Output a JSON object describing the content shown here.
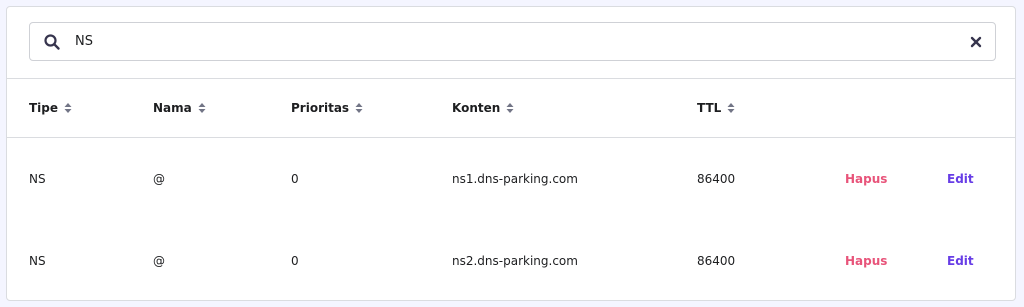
{
  "search": {
    "value": "NS",
    "placeholder": ""
  },
  "table": {
    "headers": [
      "Tipe",
      "Nama",
      "Prioritas",
      "Konten",
      "TTL"
    ],
    "rows": [
      {
        "tipe": "NS",
        "nama": "@",
        "prioritas": "0",
        "konten": "ns1.dns-parking.com",
        "ttl": "86400",
        "delete_label": "Hapus",
        "edit_label": "Edit"
      },
      {
        "tipe": "NS",
        "nama": "@",
        "prioritas": "0",
        "konten": "ns2.dns-parking.com",
        "ttl": "86400",
        "delete_label": "Hapus",
        "edit_label": "Edit"
      }
    ]
  },
  "colors": {
    "delete": "#e8547a",
    "edit": "#673de6",
    "border": "#dadce0"
  },
  "icons": {
    "search": "search-icon",
    "clear": "close-icon",
    "sort": "sort-icon"
  }
}
